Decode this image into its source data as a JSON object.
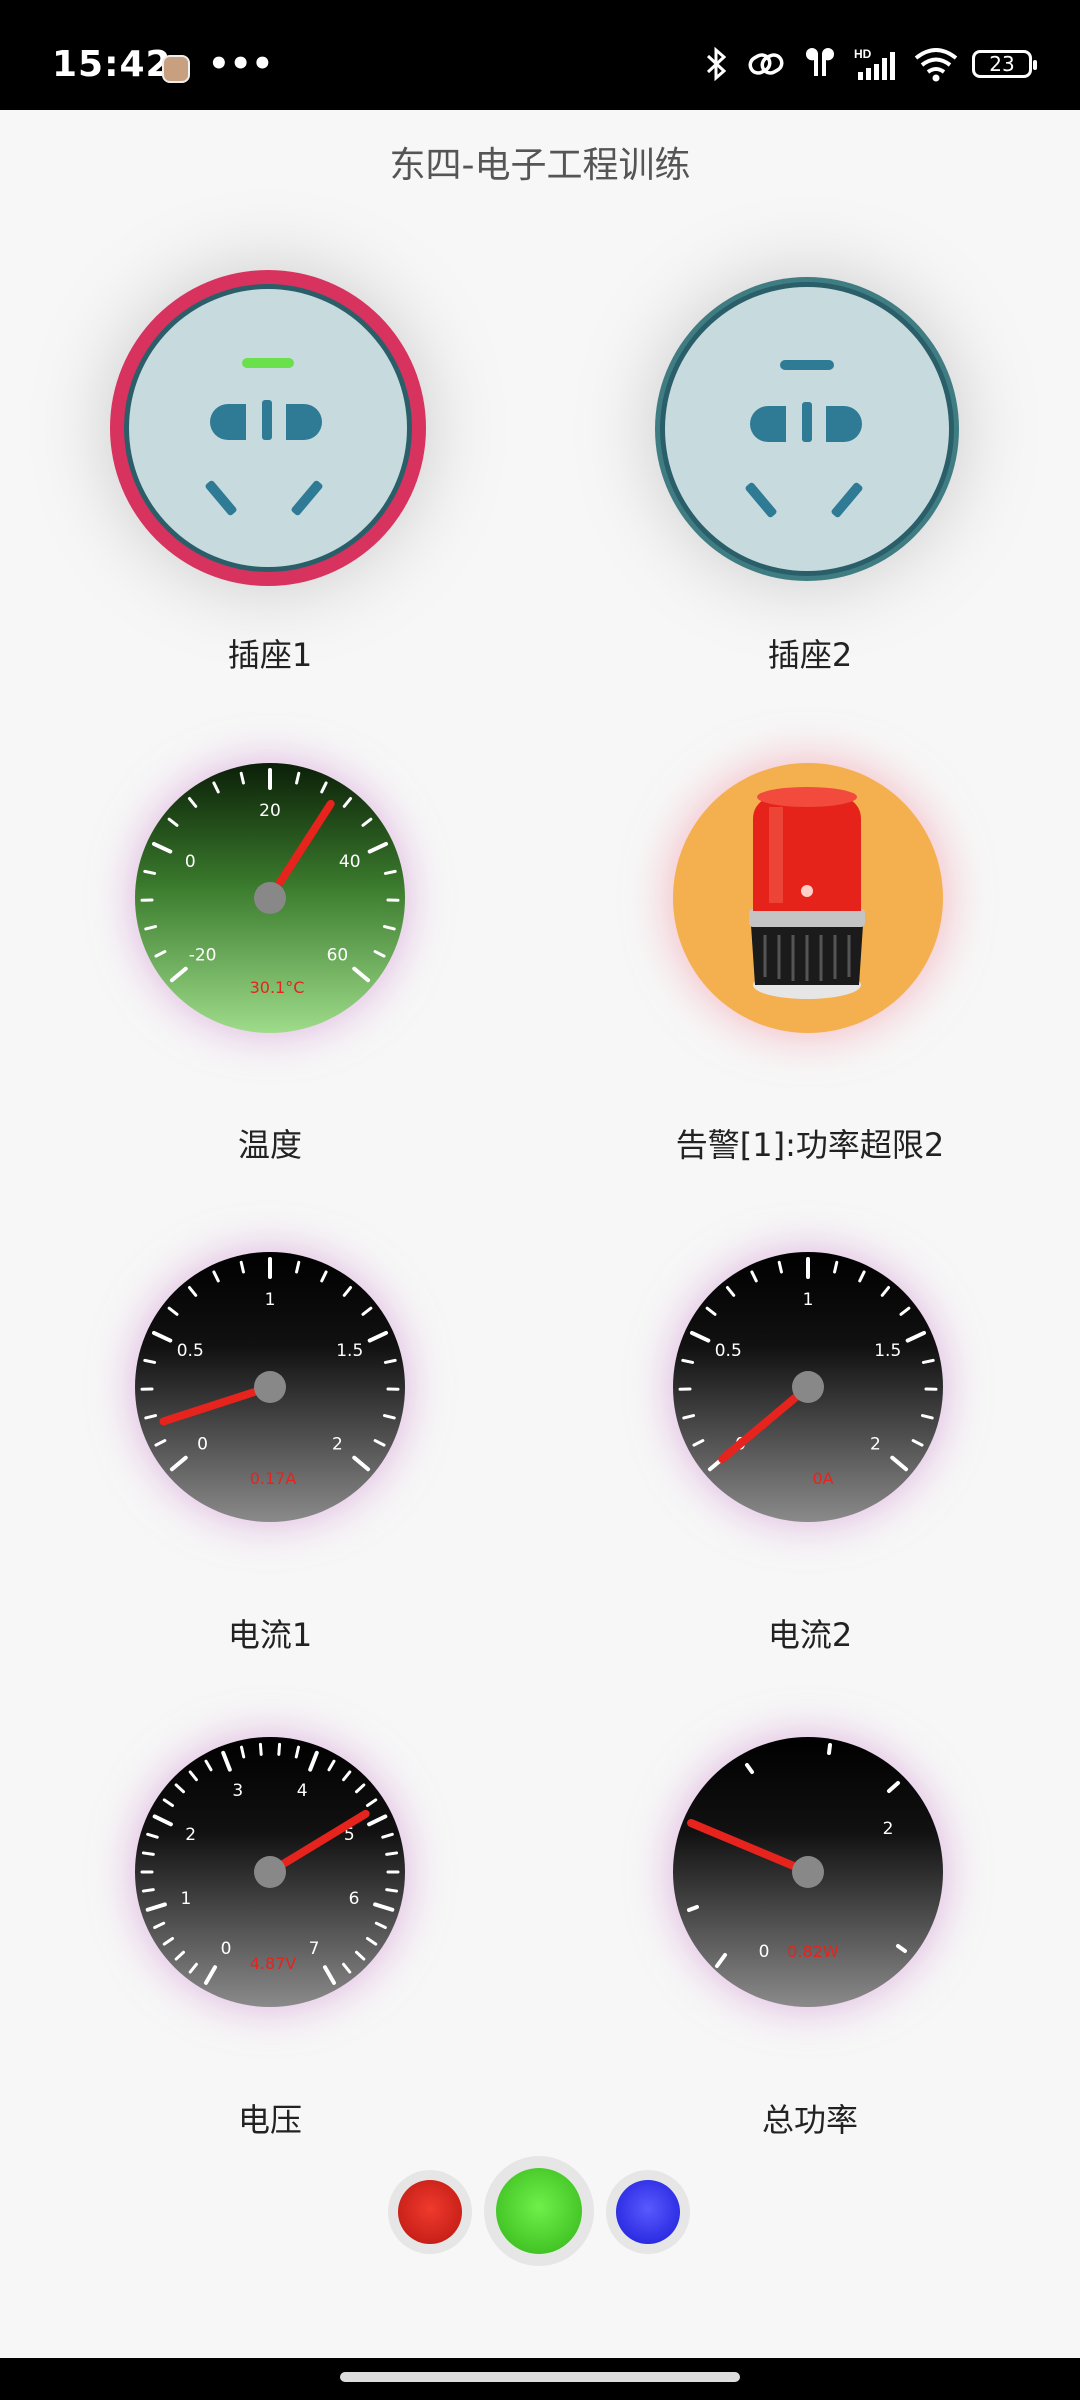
{
  "status": {
    "time": "15:42",
    "dots": "•••",
    "battery": "23"
  },
  "app": {
    "title": "东四-电子工程训练"
  },
  "sockets": [
    {
      "label": "插座1",
      "state": "on",
      "ring_color": "#d8325e",
      "indicator_color": "#6be04d"
    },
    {
      "label": "插座2",
      "state": "off",
      "ring_color": "#3f7d83",
      "indicator_color": "#2f7b95"
    }
  ],
  "temperature": {
    "label": "温度",
    "readout": "30.1°C",
    "value": 30.1,
    "min": -20,
    "max": 60,
    "ticks": [
      "-20",
      "0",
      "20",
      "40",
      "60"
    ]
  },
  "alarm": {
    "label": "告警[1]:功率超限2",
    "bg_color": "#f4b04f"
  },
  "current1": {
    "label": "电流1",
    "readout": "0.17A",
    "value": 0.17,
    "min": 0,
    "max": 2,
    "ticks": [
      "0",
      "0.5",
      "1",
      "1.5",
      "2"
    ]
  },
  "current2": {
    "label": "电流2",
    "readout": "0A",
    "value": 0,
    "min": 0,
    "max": 2,
    "ticks": [
      "0",
      "0.5",
      "1",
      "1.5",
      "2"
    ]
  },
  "voltage": {
    "label": "电压",
    "readout": "4.87V",
    "value": 4.87,
    "min": 0,
    "max": 7,
    "ticks": [
      "0",
      "1",
      "2",
      "3",
      "4",
      "5",
      "6",
      "7"
    ]
  },
  "power": {
    "label": "总功率",
    "readout": "0.82W",
    "value": 0.82,
    "ticks": [
      "0",
      "2"
    ]
  },
  "buttons": [
    {
      "name": "red",
      "color": "#e02a20"
    },
    {
      "name": "green",
      "color": "#4fdc2c"
    },
    {
      "name": "blue",
      "color": "#3a3aff"
    }
  ]
}
